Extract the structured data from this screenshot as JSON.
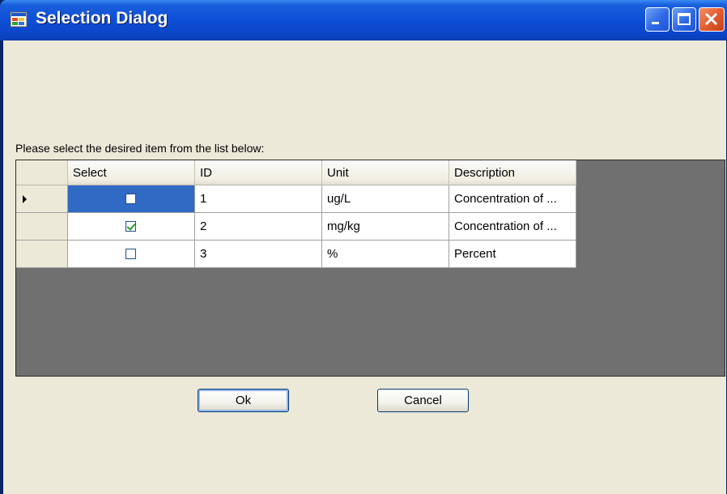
{
  "window": {
    "title": "Selection Dialog",
    "controls": [
      "minimize-icon",
      "maximize-icon",
      "close-icon"
    ]
  },
  "prompt": "Please select the desired item from the list below:",
  "grid": {
    "columns": [
      "Select",
      "ID",
      "Unit",
      "Description"
    ],
    "rows": [
      {
        "selected": false,
        "id": "1",
        "unit": "ug/L",
        "description": "Concentration of ...",
        "current": true
      },
      {
        "selected": true,
        "id": "2",
        "unit": "mg/kg",
        "description": "Concentration of ...",
        "current": false
      },
      {
        "selected": false,
        "id": "3",
        "unit": "%",
        "description": "Percent",
        "current": false
      }
    ]
  },
  "buttons": {
    "ok": "Ok",
    "cancel": "Cancel"
  },
  "colors": {
    "titlebar": "#0d4fd6",
    "client": "#ece9d8",
    "grid_background": "#707070",
    "selection": "#316ac5",
    "check": "#21a121"
  }
}
